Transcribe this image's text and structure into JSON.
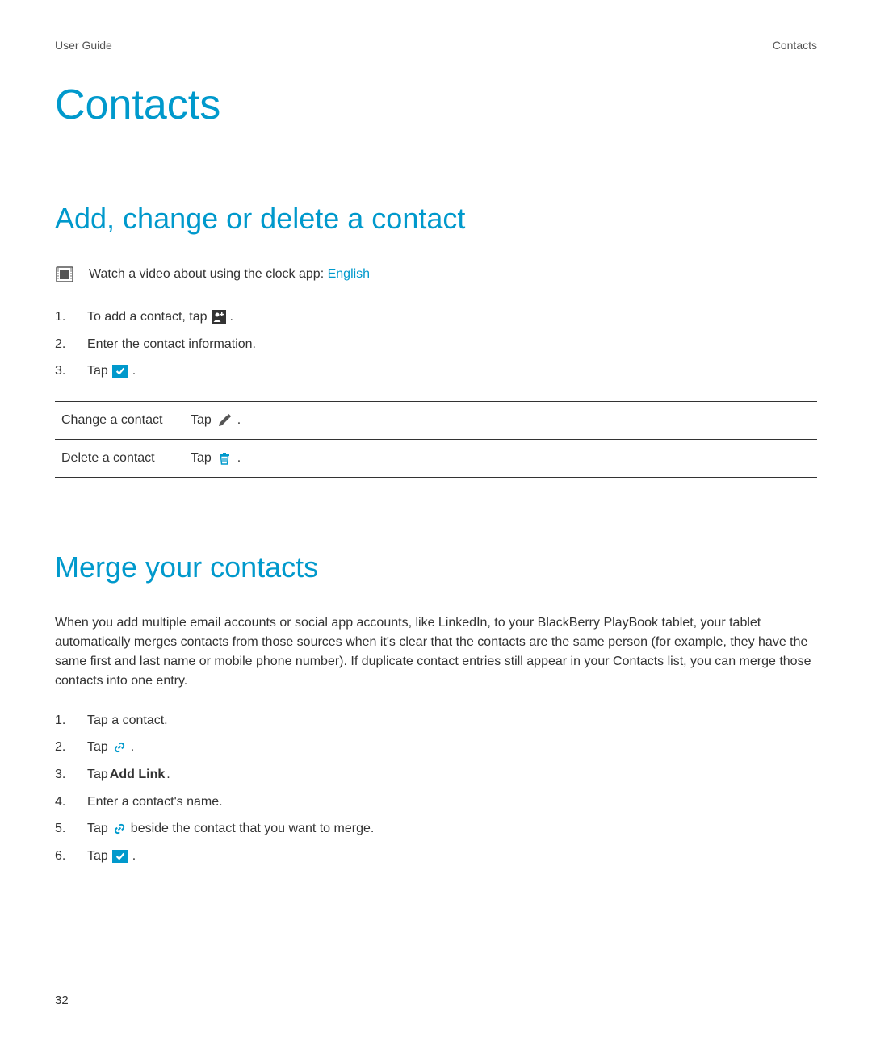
{
  "header": {
    "left": "User Guide",
    "right": "Contacts"
  },
  "title": "Contacts",
  "section1": {
    "heading": "Add, change or delete a contact",
    "video_text": "Watch a video about using the clock app: ",
    "video_link": "English",
    "steps": {
      "s1_pre": "To add a contact, tap ",
      "s1_post": " .",
      "s2": "Enter the contact information.",
      "s3_pre": "Tap ",
      "s3_post": " ."
    },
    "table": {
      "row1_label": "Change a contact",
      "row1_action_pre": "Tap ",
      "row1_action_post": " .",
      "row2_label": "Delete a contact",
      "row2_action_pre": "Tap ",
      "row2_action_post": " ."
    }
  },
  "section2": {
    "heading": "Merge your contacts",
    "paragraph": "When you add multiple email accounts or social app accounts, like LinkedIn, to your BlackBerry PlayBook tablet, your tablet automatically merges contacts from those sources when it's clear that the contacts are the same person (for example, they have the same first and last name or mobile phone number). If duplicate contact entries still appear in your Contacts list, you can merge those contacts into one entry.",
    "steps": {
      "s1": "Tap a contact.",
      "s2_pre": "Tap ",
      "s2_post": " .",
      "s3_pre": "Tap ",
      "s3_bold": "Add Link",
      "s3_post": ".",
      "s4": "Enter a contact's name.",
      "s5_pre": "Tap ",
      "s5_post": " beside the contact that you want to merge.",
      "s6_pre": "Tap ",
      "s6_post": " ."
    }
  },
  "page_number": "32"
}
